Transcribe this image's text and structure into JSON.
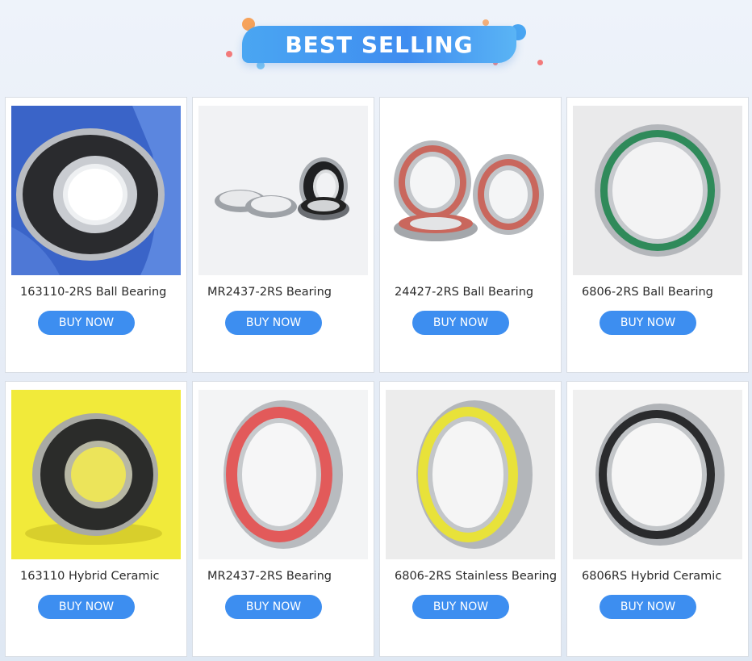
{
  "header": {
    "title": "BEST SELLING"
  },
  "products": [
    {
      "title": "163110-2RS Ball Bearing",
      "button": "BUY NOW",
      "image_icon": "ball-bearing-black-seal-in-hand"
    },
    {
      "title": "MR2437-2RS Bearing",
      "button": "BUY NOW",
      "image_icon": "bearings-group-black-and-metal"
    },
    {
      "title": "24427-2RS Ball Bearing",
      "button": "BUY NOW",
      "image_icon": "bearings-red-seal-group"
    },
    {
      "title": "6806-2RS Ball Bearing",
      "button": "BUY NOW",
      "image_icon": "bearing-green-seal"
    },
    {
      "title": "163110 Hybrid Ceramic",
      "button": "BUY NOW",
      "image_icon": "bearing-black-seal-yellow-bg"
    },
    {
      "title": "MR2437-2RS Bearing",
      "button": "BUY NOW",
      "image_icon": "bearing-red-seal"
    },
    {
      "title": "6806-2RS Stainless Bearing",
      "button": "BUY NOW",
      "image_icon": "bearing-yellow-seal"
    },
    {
      "title": "6806RS Hybrid Ceramic",
      "button": "BUY NOW",
      "image_icon": "bearing-black-seal"
    }
  ],
  "colors": {
    "button": "#3d8ef0",
    "banner": "#4aa6f2"
  }
}
